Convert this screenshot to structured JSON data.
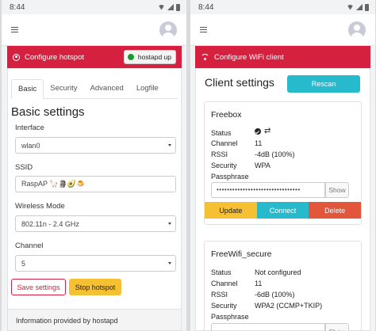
{
  "left": {
    "status_time": "8:44",
    "header_title": "Configure hotspot",
    "hostapd_badge": "hostapd up",
    "tabs": [
      "Basic",
      "Security",
      "Advanced",
      "Logfile"
    ],
    "section_title": "Basic settings",
    "interface": {
      "label": "Interface",
      "value": "wlan0"
    },
    "ssid": {
      "label": "SSID",
      "value": "RaspAP 🦙🗿🥑🍮"
    },
    "wireless_mode": {
      "label": "Wireless Mode",
      "value": "802.11n - 2.4 GHz"
    },
    "channel": {
      "label": "Channel",
      "value": "5"
    },
    "save_label": "Save settings",
    "stop_label": "Stop hotspot",
    "footer": "Information provided by hostapd",
    "accent_color": "#d6203f"
  },
  "right": {
    "status_time": "8:44",
    "header_title": "Configure WiFi client",
    "section_title": "Client settings",
    "rescan_label": "Rescan",
    "networks": [
      {
        "name": "Freebox",
        "status_label": "Status",
        "channel_label": "Channel",
        "channel": "11",
        "rssi_label": "RSSI",
        "rssi": "-4dB (100%)",
        "security_label": "Security",
        "security": "WPA",
        "passphrase_label": "Passphrase",
        "passphrase": "••••••••••••••••••••••••••••••••",
        "show_label": "Show",
        "update_label": "Update",
        "connect_label": "Connect",
        "delete_label": "Delete"
      },
      {
        "name": "FreeWifi_secure",
        "status_label": "Status",
        "status": "Not configured",
        "channel_label": "Channel",
        "channel": "11",
        "rssi_label": "RSSI",
        "rssi": "-6dB (100%)",
        "security_label": "Security",
        "security": "WPA2 (CCMP+TKIP)",
        "passphrase_label": "Passphrase",
        "show_label": "Show"
      }
    ]
  }
}
